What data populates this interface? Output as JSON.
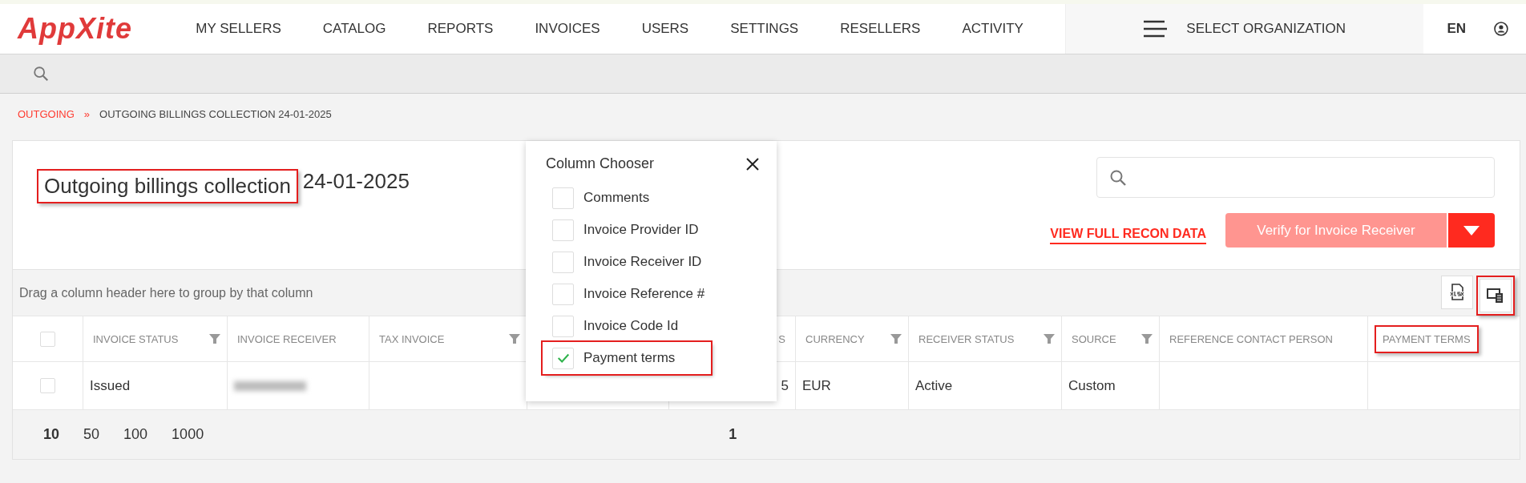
{
  "nav": {
    "logo": "AppXite",
    "items": [
      "MY SELLERS",
      "CATALOG",
      "REPORTS",
      "INVOICES",
      "USERS",
      "SETTINGS",
      "RESELLERS",
      "ACTIVITY"
    ],
    "org_selector": "SELECT ORGANIZATION",
    "language": "EN"
  },
  "breadcrumb": [
    {
      "label": "OUTGOING",
      "kind": "link"
    },
    {
      "label": "»",
      "kind": "separator"
    },
    {
      "label": "OUTGOING BILLINGS COLLECTION 24-01-2025",
      "kind": "current"
    }
  ],
  "page": {
    "title": {
      "text": "Outgoing billings collection",
      "highlighted": true
    },
    "date": "24-01-2025",
    "recon_link": "VIEW FULL RECON DATA",
    "verify_button": {
      "label": "Verify for Invoice Receiver",
      "disabled": true
    }
  },
  "grid": {
    "group_hint": "Drag a column header here to group by that column",
    "toolbar": [
      {
        "kind": "xlsx",
        "highlighted": false
      },
      {
        "kind": "column_chooser",
        "highlighted": true
      }
    ],
    "columns": [
      {
        "kind": "checkbox",
        "checked": false
      },
      {
        "kind": "text",
        "label": "INVOICE STATUS",
        "filter": true,
        "highlighted": false
      },
      {
        "kind": "text",
        "label": "INVOICE RECEIVER",
        "filter": false,
        "highlighted": false
      },
      {
        "kind": "text",
        "label": "TAX INVOICE",
        "filter": true,
        "highlighted": false
      },
      {
        "kind": "hidden"
      },
      {
        "kind": "partial",
        "label": "S",
        "filter": false,
        "highlighted": false
      },
      {
        "kind": "text",
        "label": "CURRENCY",
        "filter": true,
        "highlighted": false
      },
      {
        "kind": "text",
        "label": "RECEIVER STATUS",
        "filter": true,
        "highlighted": false
      },
      {
        "kind": "text",
        "label": "SOURCE",
        "filter": true,
        "highlighted": false
      },
      {
        "kind": "text",
        "label": "REFERENCE CONTACT PERSON",
        "filter": false,
        "highlighted": false
      },
      {
        "kind": "text",
        "label": "PAYMENT TERMS",
        "filter": false,
        "highlighted": true
      }
    ],
    "rows": [
      {
        "selected": false,
        "cells": [
          {
            "kind": "checkbox"
          },
          {
            "kind": "text",
            "text": "Issued"
          },
          {
            "kind": "redacted"
          },
          {
            "kind": "blank"
          },
          {
            "kind": "blank"
          },
          {
            "kind": "text",
            "text": "5"
          },
          {
            "kind": "text",
            "text": "EUR"
          },
          {
            "kind": "text",
            "text": "Active"
          },
          {
            "kind": "text",
            "text": "Custom"
          },
          {
            "kind": "blank"
          },
          {
            "kind": "blank"
          }
        ]
      }
    ],
    "page_sizes": [
      {
        "label": "10",
        "selected": true
      },
      {
        "label": "50",
        "selected": false
      },
      {
        "label": "100",
        "selected": false
      },
      {
        "label": "1000",
        "selected": false
      }
    ],
    "pages": [
      {
        "label": "1",
        "selected": true
      }
    ]
  },
  "column_chooser": {
    "title": "Column Chooser",
    "items": [
      {
        "label": "Comments",
        "checked": false,
        "highlighted": false
      },
      {
        "label": "Invoice Provider ID",
        "checked": false,
        "highlighted": false
      },
      {
        "label": "Invoice Receiver ID",
        "checked": false,
        "highlighted": false
      },
      {
        "label": "Invoice Reference #",
        "checked": false,
        "highlighted": false
      },
      {
        "label": "Invoice Code Id",
        "checked": false,
        "highlighted": false
      },
      {
        "label": "Payment terms",
        "checked": true,
        "highlighted": true
      }
    ]
  }
}
